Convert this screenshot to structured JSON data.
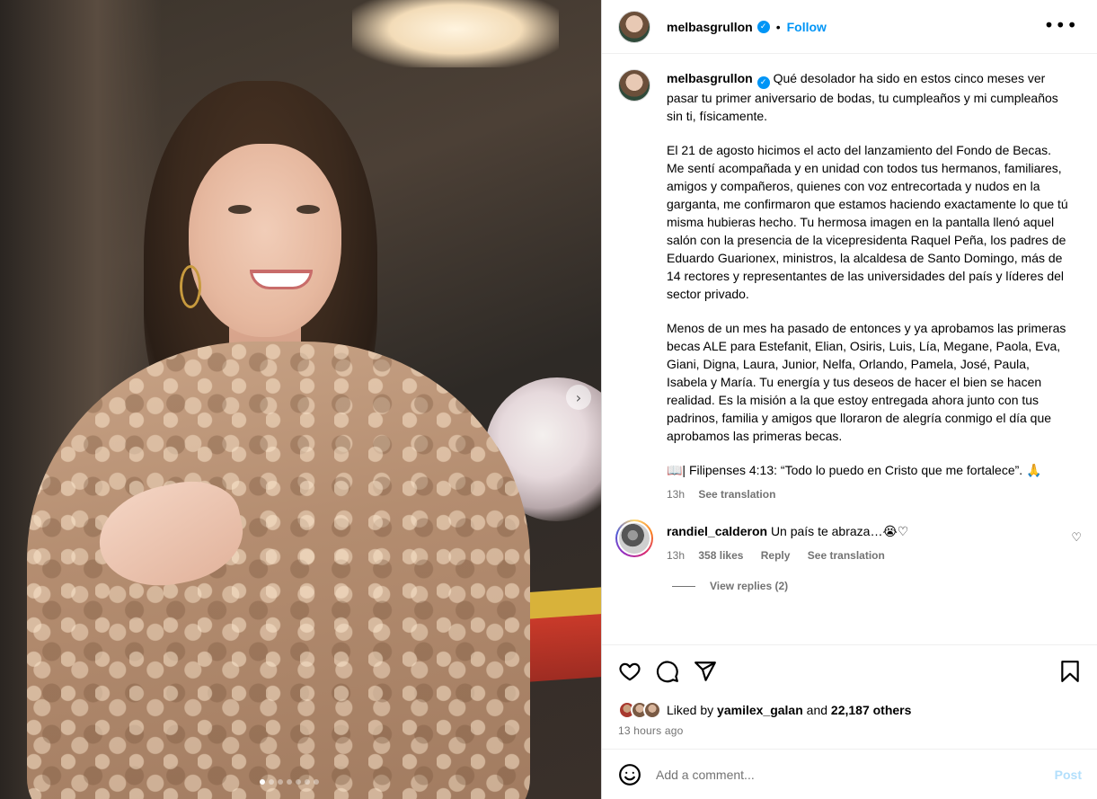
{
  "header": {
    "username": "melbasgrullon",
    "separator": "•",
    "follow_label": "Follow",
    "more_label": "•••"
  },
  "caption": {
    "username": "melbasgrullon",
    "paragraphs": [
      "Qué desolador ha sido en estos cinco meses ver pasar tu primer aniversario de bodas, tu cumpleaños y mi cumpleaños sin ti, físicamente.",
      "El 21 de agosto hicimos el acto del lanzamiento del Fondo de Becas. Me sentí acompañada y en unidad con todos tus hermanos, familiares, amigos y compañeros, quienes con voz entrecortada y nudos en la garganta, me confirmaron que estamos haciendo exactamente lo que tú misma hubieras hecho. Tu hermosa imagen en la pantalla llenó aquel salón con la presencia de la vicepresidenta Raquel Peña, los padres de Eduardo Guarionex, ministros, la alcaldesa de Santo Domingo, más de 14 rectores y representantes de las universidades del país y líderes del sector privado.",
      "Menos de un mes ha pasado de entonces y ya aprobamos las primeras becas ALE para Estefanit, Elian, Osiris, Luis, Lía, Megane, Paola, Eva, Giani, Digna, Laura, Junior, Nelfa, Orlando, Pamela, José, Paula, Isabela y María. Tu energía y tus deseos de hacer el bien se hacen realidad. Es la misión a la que estoy entregada ahora junto con tus padrinos, familia y amigos que lloraron de alegría conmigo el día que aprobamos las primeras becas.",
      "📖| Filipenses 4:13: “Todo lo puedo en Cristo que me fortalece”. 🙏"
    ],
    "time": "13h",
    "see_translation": "See translation"
  },
  "comment": {
    "username": "randiel_calderon",
    "text": "Un país te abraza…😭♡",
    "time": "13h",
    "likes": "358 likes",
    "reply": "Reply",
    "see_translation": "See translation",
    "view_replies": "View replies (2)"
  },
  "likes": {
    "prefix": "Liked by",
    "user": "yamilex_galan",
    "middle": "and",
    "others": "22,187 others",
    "time_ago": "13 hours ago"
  },
  "add_comment": {
    "placeholder": "Add a comment...",
    "post_label": "Post"
  },
  "carousel": {
    "next_label": "›",
    "slide_count": 7,
    "active_index": 0
  },
  "colors": {
    "accent": "#0095f6",
    "post_disabled": "#b2dffc",
    "secondary_text": "#737373"
  }
}
